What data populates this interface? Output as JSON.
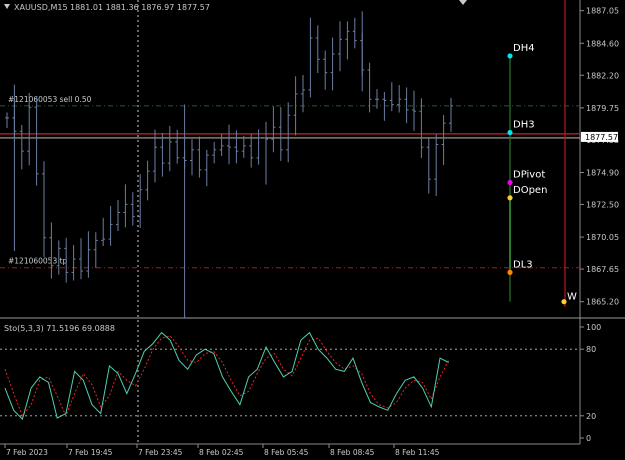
{
  "header": {
    "symbol_label": "XAUUSD,M15",
    "ohlc_label": "1881.01 1881.36 1876.97 1877.57"
  },
  "price_axis": {
    "ticks": [
      "1887.05",
      "1884.60",
      "1882.20",
      "1879.75",
      "1877.35",
      "1874.90",
      "1872.50",
      "1870.05",
      "1867.65",
      "1865.20"
    ],
    "current_price": "1877.57"
  },
  "orders": [
    {
      "label": "#121060053 sell 0.50",
      "price": 1879.9
    },
    {
      "label": "#121060053 tp",
      "price": 1867.75
    }
  ],
  "levels": [
    {
      "label": "DH4",
      "price": 1883.65,
      "color": "#00e5ee"
    },
    {
      "label": "DH3",
      "price": 1877.9,
      "color": "#00e5ee"
    },
    {
      "label": "DPivot",
      "price": 1874.15,
      "color": "#ee00ee"
    },
    {
      "label": "DOpen",
      "price": 1873.0,
      "color": "#ffcc33"
    },
    {
      "label": "DL3",
      "price": 1867.4,
      "color": "#ff8800"
    }
  ],
  "cut_label": "W",
  "indicator": {
    "label": "Sto(5,3,3) 71.5196 69.0888",
    "ticks": [
      "100",
      "80",
      "20",
      "0"
    ]
  },
  "time_axis": [
    "7 Feb 2023",
    "7 Feb 19:45",
    "7 Feb 23:45",
    "8 Feb 02:45",
    "8 Feb 05:45",
    "8 Feb 08:45",
    "8 Feb 11:45"
  ],
  "colors": {
    "background": "#000000",
    "bars": "#6b7fa3",
    "grid": "#ffffff",
    "order_line": "#1f5c2c",
    "tp_line": "#b01818",
    "price_line": "#d8d8d8",
    "bid_line": "#ff2a2a",
    "stoch_main": "#4fd0b0",
    "stoch_signal": "#ee2222",
    "text": "#c8c8c8"
  },
  "chart_data": {
    "type": "ohlc",
    "price_range": [
      1864.0,
      1887.6
    ],
    "prices": [
      1879.0,
      1878.0,
      1876.5,
      1879.8,
      1874.8,
      1870.0,
      1867.9,
      1869.2,
      1867.4,
      1868.4,
      1867.5,
      1869.1,
      1869.8,
      1869.9,
      1871.0,
      1871.9,
      1872.5,
      1871.6,
      1873.6,
      1875.0,
      1876.8,
      1875.6,
      1877.2,
      1876.0,
      1875.8,
      1876.6,
      1875.1,
      1876.2,
      1876.6,
      1876.9,
      1876.8,
      1876.5,
      1876.9,
      1876.0,
      1877.5,
      1877.4,
      1878.3,
      1876.6,
      1879.2,
      1880.8,
      1881.1,
      1885.0,
      1883.4,
      1882.4,
      1883.8,
      1884.9,
      1885.5,
      1884.8,
      1882.6,
      1880.4,
      1880.4,
      1880.3,
      1880.0,
      1880.4,
      1879.6,
      1879.5,
      1876.8,
      1874.4,
      1877.0,
      1878.6,
      1879.9
    ],
    "stochastic": {
      "main": [
        45,
        25,
        17,
        45,
        55,
        50,
        18,
        22,
        60,
        52,
        30,
        22,
        65,
        58,
        40,
        58,
        78,
        85,
        95,
        88,
        70,
        62,
        75,
        80,
        76,
        55,
        42,
        30,
        55,
        62,
        82,
        68,
        55,
        60,
        88,
        95,
        80,
        72,
        62,
        60,
        72,
        50,
        32,
        28,
        25,
        40,
        52,
        55,
        45,
        28,
        72,
        68
      ],
      "signal": [
        62,
        40,
        20,
        30,
        52,
        55,
        38,
        20,
        40,
        58,
        48,
        28,
        38,
        60,
        52,
        47,
        62,
        80,
        90,
        92,
        82,
        70,
        68,
        76,
        78,
        68,
        52,
        38,
        42,
        58,
        72,
        76,
        62,
        56,
        72,
        88,
        90,
        78,
        68,
        62,
        65,
        58,
        40,
        30,
        27,
        32,
        45,
        52,
        50,
        35,
        55,
        70
      ],
      "levels": [
        20,
        80
      ]
    }
  }
}
